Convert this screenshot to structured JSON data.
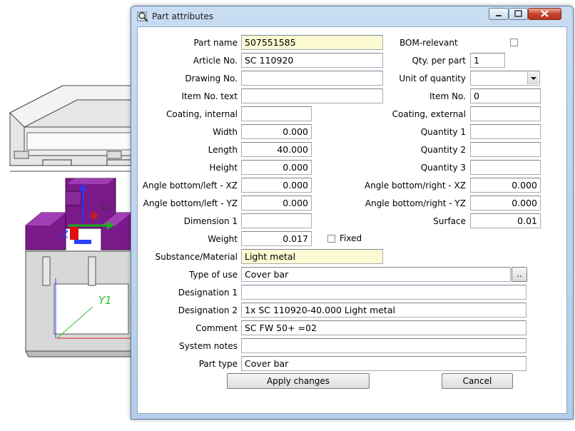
{
  "window": {
    "title": "Part attributes"
  },
  "viewport": {
    "axis_label": "Y1",
    "axis_z": "Z"
  },
  "left": {
    "part_name": {
      "label": "Part name",
      "value": "507551585"
    },
    "article_no": {
      "label": "Article No.",
      "value": "SC 110920"
    },
    "drawing_no": {
      "label": "Drawing No.",
      "value": ""
    },
    "item_text": {
      "label": "Item No. text",
      "value": ""
    },
    "coat_int": {
      "label": "Coating, internal",
      "value": ""
    },
    "width": {
      "label": "Width",
      "value": "0.000"
    },
    "length": {
      "label": "Length",
      "value": "40.000"
    },
    "height": {
      "label": "Height",
      "value": "0.000"
    },
    "ang_bl_xz": {
      "label": "Angle bottom/left - XZ",
      "value": "0.000"
    },
    "ang_bl_yz": {
      "label": "Angle bottom/left - YZ",
      "value": "0.000"
    },
    "dim1": {
      "label": "Dimension 1",
      "value": ""
    },
    "weight": {
      "label": "Weight",
      "value": "0.017"
    },
    "fixed": {
      "label": "Fixed",
      "checked": false
    },
    "material": {
      "label": "Substance/Material",
      "value": "Light metal"
    }
  },
  "right": {
    "bom": {
      "label": "BOM-relevant",
      "checked": false
    },
    "qty_part": {
      "label": "Qty. per part",
      "value": "1"
    },
    "unit_qty": {
      "label": "Unit of quantity",
      "value": ""
    },
    "item_no": {
      "label": "Item No.",
      "value": "0"
    },
    "coat_ext": {
      "label": "Coating, external",
      "value": ""
    },
    "qty1": {
      "label": "Quantity 1",
      "value": ""
    },
    "qty2": {
      "label": "Quantity 2",
      "value": ""
    },
    "qty3": {
      "label": "Quantity 3",
      "value": ""
    },
    "ang_br_xz": {
      "label": "Angle bottom/right - XZ",
      "value": "0.000"
    },
    "ang_br_yz": {
      "label": "Angle bottom/right - YZ",
      "value": "0.000"
    },
    "surface": {
      "label": "Surface",
      "value": "0.01"
    }
  },
  "wide": {
    "type_of_use": {
      "label": "Type of use",
      "value": "Cover bar",
      "browse": ".."
    },
    "desig1": {
      "label": "Designation 1",
      "value": ""
    },
    "desig2": {
      "label": "Designation 2",
      "value": "1x SC 110920-40.000 Light metal"
    },
    "comment": {
      "label": "Comment",
      "value": "SC FW 50+ =02"
    },
    "sys_notes": {
      "label": "System notes",
      "value": ""
    },
    "part_type": {
      "label": "Part type",
      "value": "Cover bar"
    }
  },
  "buttons": {
    "apply": "Apply changes",
    "cancel": "Cancel"
  },
  "colors": {
    "highlight_field": "#fbfad2",
    "profile_purple": "#7a1a8a"
  }
}
